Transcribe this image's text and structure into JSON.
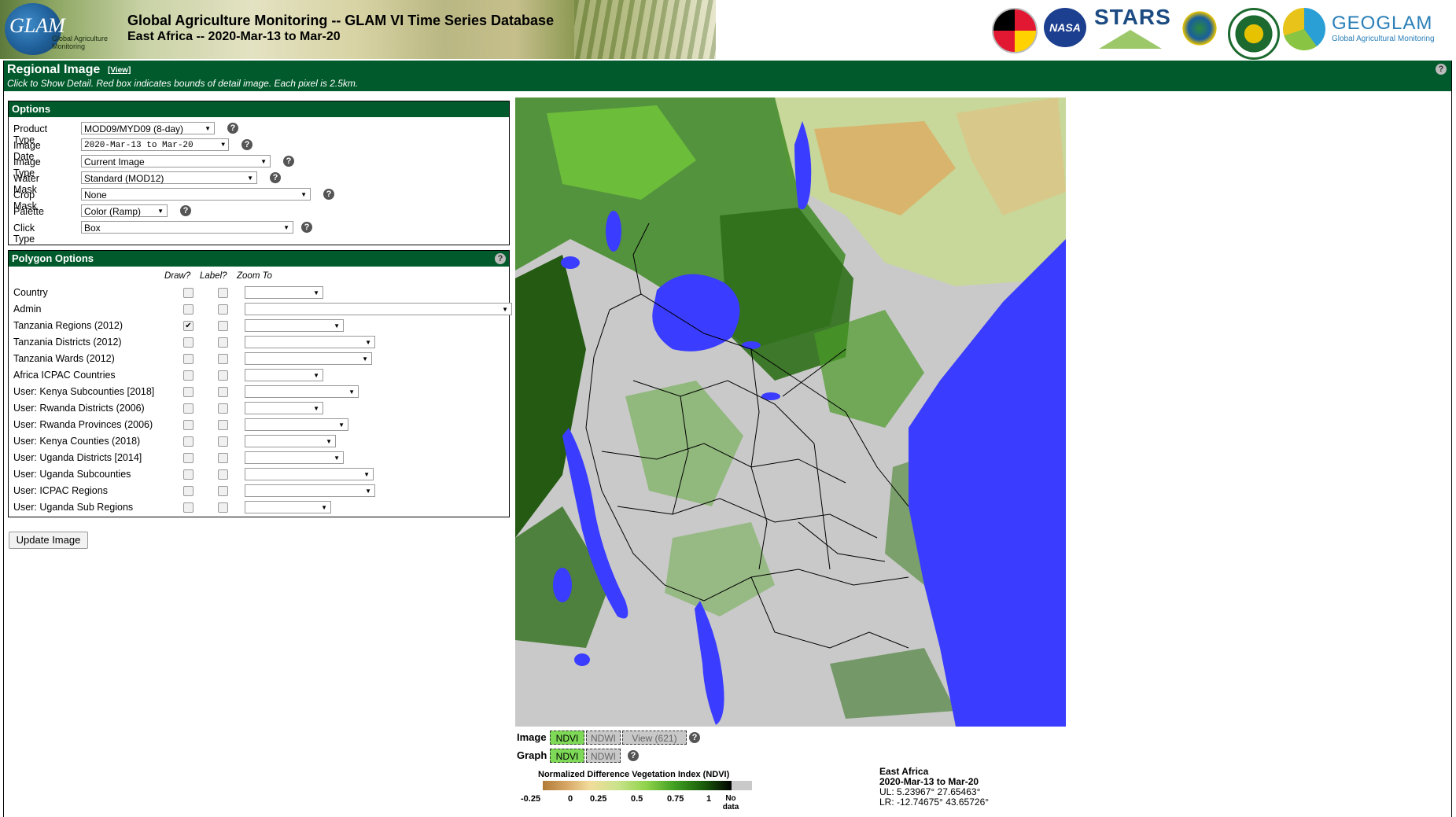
{
  "header": {
    "logo_text": "GLAM",
    "logo_sub": "Global Agriculture Monitoring",
    "title": "Global Agriculture Monitoring -- GLAM VI Time Series Database",
    "subtitle": "East Africa -- 2020-Mar-13 to Mar-20",
    "nasa_text": "NASA",
    "stars_text": "STARS",
    "geoglam_text": "GEOGLAM",
    "geoglam_sub": "Global Agricultural Monitoring"
  },
  "regional": {
    "title": "Regional Image",
    "view_link": "[View]",
    "instructions": "Click to Show Detail. Red box indicates bounds of detail image. Each pixel is 2.5km."
  },
  "options": {
    "title": "Options",
    "rows": [
      {
        "label": "Product Type",
        "value": "MOD09/MYD09 (8-day)"
      },
      {
        "label": "Image Date",
        "value": "2020-Mar-13 to Mar-20"
      },
      {
        "label": "Image Type",
        "value": "Current Image"
      },
      {
        "label": "Water Mask",
        "value": "Standard (MOD12)"
      },
      {
        "label": "Crop Mask",
        "value": "None"
      },
      {
        "label": "Palette",
        "value": "Color (Ramp)"
      },
      {
        "label": "Click Type",
        "value": "Box"
      }
    ]
  },
  "polygon": {
    "title": "Polygon Options",
    "col_draw": "Draw?",
    "col_label": "Label?",
    "col_zoom": "Zoom To",
    "rows": [
      {
        "label": "Country",
        "draw": false
      },
      {
        "label": "Admin",
        "draw": false
      },
      {
        "label": "Tanzania Regions (2012)",
        "draw": true
      },
      {
        "label": "Tanzania Districts (2012)",
        "draw": false
      },
      {
        "label": "Tanzania Wards (2012)",
        "draw": false
      },
      {
        "label": "Africa ICPAC Countries",
        "draw": false
      },
      {
        "label": "User: Kenya Subcounties [2018]",
        "draw": false
      },
      {
        "label": "User: Rwanda Districts (2006)",
        "draw": false
      },
      {
        "label": "User: Rwanda Provinces (2006)",
        "draw": false
      },
      {
        "label": "User: Kenya Counties (2018)",
        "draw": false
      },
      {
        "label": "User: Uganda Districts [2014]",
        "draw": false
      },
      {
        "label": "User: Uganda Subcounties",
        "draw": false
      },
      {
        "label": "User: ICPAC Regions",
        "draw": false
      },
      {
        "label": "User: Uganda Sub Regions",
        "draw": false
      }
    ]
  },
  "update_button": "Update Image",
  "image_tabs": {
    "image_label": "Image",
    "graph_label": "Graph",
    "ndvi": "NDVI",
    "ndwi": "NDWI",
    "view": "View (621)"
  },
  "legend": {
    "title": "Normalized Difference Vegetation Index (NDVI)",
    "ticks": [
      "-0.25",
      "0",
      "0.25",
      "0.5",
      "0.75",
      "1"
    ],
    "no_data": "No data"
  },
  "info": {
    "region": "East Africa",
    "date": "2020-Mar-13 to Mar-20",
    "ul": "UL: 5.23967° 27.65463°",
    "lr": "LR: -12.74675° 43.65726°"
  },
  "colors": {
    "header_green": "#005a2c",
    "water_blue": "#3a3cff",
    "no_data_gray": "#c9c9c9",
    "tab_active": "#7ed957"
  }
}
